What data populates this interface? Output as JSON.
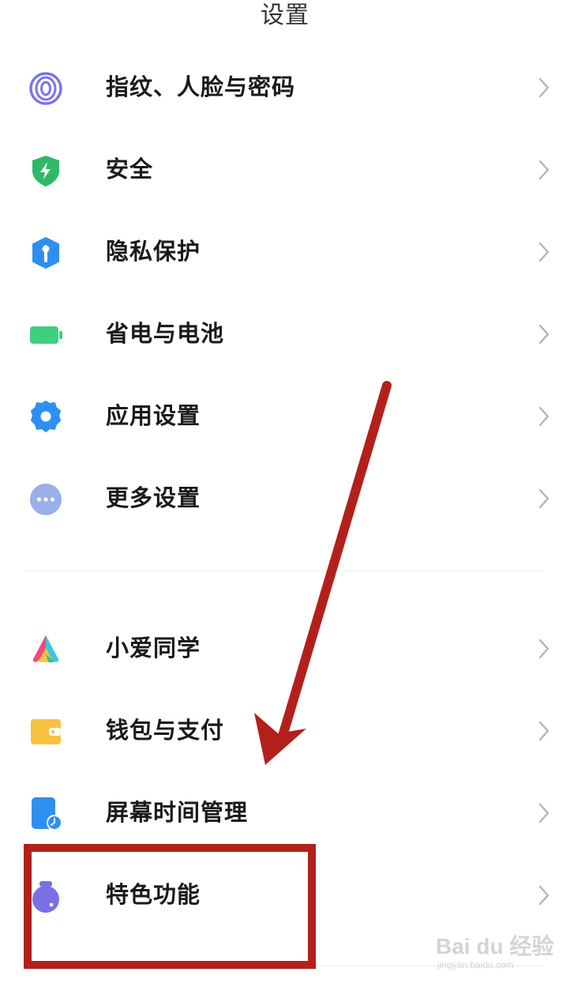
{
  "header": {
    "title": "设置"
  },
  "items": [
    {
      "label": "指纹、人脸与密码",
      "icon": "fingerprint-icon"
    },
    {
      "label": "安全",
      "icon": "security-shield-icon"
    },
    {
      "label": "隐私保护",
      "icon": "privacy-icon"
    },
    {
      "label": "省电与电池",
      "icon": "battery-icon"
    },
    {
      "label": "应用设置",
      "icon": "app-settings-gear-icon"
    },
    {
      "label": "更多设置",
      "icon": "more-dots-icon"
    },
    {
      "label": "小爱同学",
      "icon": "xiaoai-assistant-icon"
    },
    {
      "label": "钱包与支付",
      "icon": "wallet-icon"
    },
    {
      "label": "屏幕时间管理",
      "icon": "screen-time-icon"
    },
    {
      "label": "特色功能",
      "icon": "special-features-icon"
    }
  ],
  "watermark": {
    "brand": "Bai du 经验",
    "url": "jingyan.baidu.com"
  },
  "colors": {
    "annotation_red": "#b3201b",
    "fingerprint": "#7b74e8",
    "security": "#2fb868",
    "privacy": "#2f8ff0",
    "battery": "#3ed07f",
    "app_settings": "#2f8ff0",
    "more": "#9aaee8",
    "wallet": "#f6c240",
    "screen_time": "#2f8ff0",
    "special": "#7b6fe6"
  }
}
